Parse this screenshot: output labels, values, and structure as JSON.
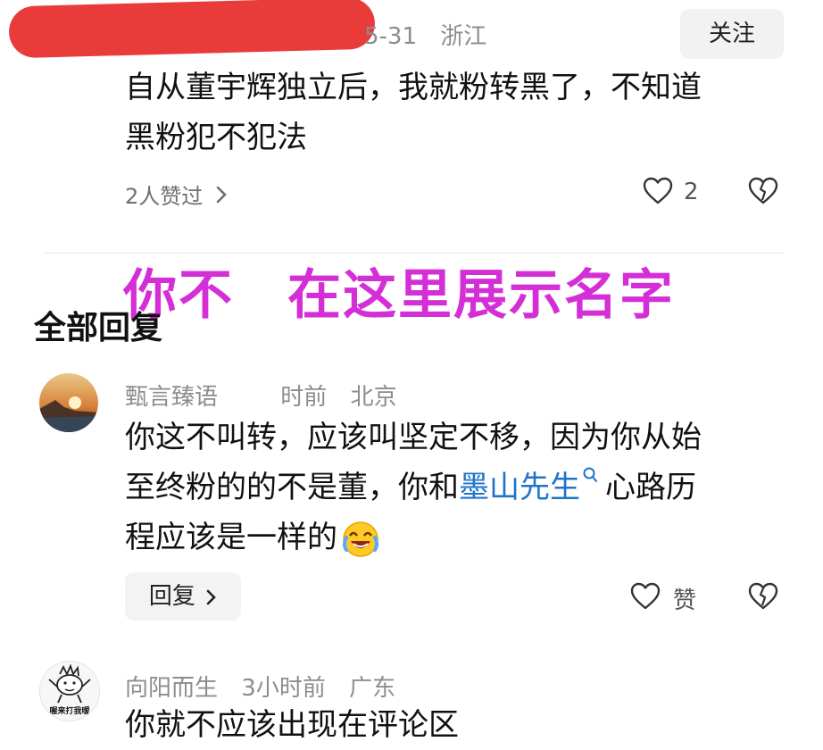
{
  "top_comment": {
    "meta_date": "5-31",
    "meta_location": "浙江",
    "follow_label": "关注",
    "line1": "自从董宇辉独立后，我就粉转黑了，不知道",
    "line2": "黑粉犯不犯法",
    "likes_summary": "2人赞过",
    "like_count": "2"
  },
  "overlay_text": {
    "part1": "你不",
    "part2": "在这里展示名字"
  },
  "section_title": "全部回复",
  "reply1": {
    "username": "甄言臻语",
    "time": "时前",
    "location": "北京",
    "line1": "你这不叫转，应该叫坚定不移，因为你从始",
    "line2_prefix": "至终粉的的不是董，你和",
    "mention": "墨山先生",
    "line2_suffix": "心路历",
    "line3": "程应该是一样的",
    "reply_label": "回复",
    "like_label": "赞"
  },
  "reply2": {
    "username": "向阳而生",
    "time": "3小时前",
    "location": "广东",
    "line1": "你就不应该出现在评论区",
    "avatar_caption": "喔来打我嗳"
  },
  "colors": {
    "overlay": "#d42fd6",
    "mention": "#1f74c8",
    "redaction": "#ea3b3b"
  }
}
